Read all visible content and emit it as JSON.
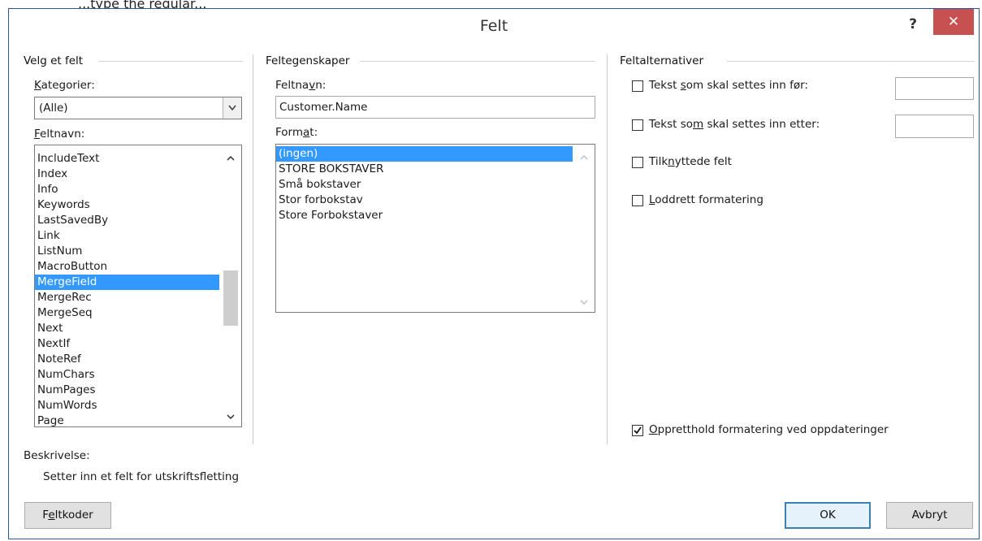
{
  "page_top_partial_text": "...type the regular...",
  "dialog": {
    "title": "Felt",
    "help_label": "?",
    "close_label": "✕"
  },
  "choose_field": {
    "group_title": "Velg et felt",
    "categories_label_a": "K",
    "categories_label_b": "ategorier:",
    "category_value": "(Alle)",
    "fieldnames_label_a": "F",
    "fieldnames_label_b": "eltnavn:",
    "fields": [
      {
        "label": "IncludeText",
        "selected": false
      },
      {
        "label": "Index",
        "selected": false
      },
      {
        "label": "Info",
        "selected": false
      },
      {
        "label": "Keywords",
        "selected": false
      },
      {
        "label": "LastSavedBy",
        "selected": false
      },
      {
        "label": "Link",
        "selected": false
      },
      {
        "label": "ListNum",
        "selected": false
      },
      {
        "label": "MacroButton",
        "selected": false
      },
      {
        "label": "MergeField",
        "selected": true
      },
      {
        "label": "MergeRec",
        "selected": false
      },
      {
        "label": "MergeSeq",
        "selected": false
      },
      {
        "label": "Next",
        "selected": false
      },
      {
        "label": "NextIf",
        "selected": false
      },
      {
        "label": "NoteRef",
        "selected": false
      },
      {
        "label": "NumChars",
        "selected": false
      },
      {
        "label": "NumPages",
        "selected": false
      },
      {
        "label": "NumWords",
        "selected": false
      },
      {
        "label": "Page",
        "selected": false
      }
    ]
  },
  "field_properties": {
    "group_title": "Feltegenskaper",
    "fieldname_label_a": "Feltna",
    "fieldname_label_b": "v",
    "fieldname_label_c": "n:",
    "fieldname_value": "Customer.Name",
    "format_label_a": "Form",
    "format_label_b": "a",
    "format_label_c": "t:",
    "formats": [
      {
        "label": "(ingen)",
        "selected": true
      },
      {
        "label": "STORE BOKSTAVER",
        "selected": false
      },
      {
        "label": "Små bokstaver",
        "selected": false
      },
      {
        "label": "Stor forbokstav",
        "selected": false
      },
      {
        "label": "Store Forbokstaver",
        "selected": false
      }
    ]
  },
  "field_options": {
    "group_title": "Feltalternativer",
    "opt_before_a": "Tekst ",
    "opt_before_b": "s",
    "opt_before_c": "om skal settes inn før:",
    "opt_after_a": "Tekst so",
    "opt_after_b": "m",
    "opt_after_c": " skal settes inn etter:",
    "opt_mapped_a": "Tilk",
    "opt_mapped_b": "n",
    "opt_mapped_c": "yttede felt",
    "opt_vertical_a": "L",
    "opt_vertical_b": "oddrett formatering",
    "keep_format_a": "O",
    "keep_format_b": "ppretthold formatering ved oppdateringer",
    "keep_format_checked": true
  },
  "description": {
    "label": "Beskrivelse:",
    "text": "Setter inn et felt for utskriftsfletting"
  },
  "buttons": {
    "field_codes_a": "F",
    "field_codes_b": "e",
    "field_codes_c": "ltkoder",
    "ok": "OK",
    "cancel": "Avbryt"
  },
  "icons": {
    "dropdown": "chevron-down-icon",
    "scroll_up": "chevron-up-icon",
    "scroll_down": "chevron-down-icon",
    "check": "check-icon"
  },
  "colors": {
    "selection": "#3399ff",
    "close_button": "#c75050",
    "frame_border": "#2b5797"
  }
}
